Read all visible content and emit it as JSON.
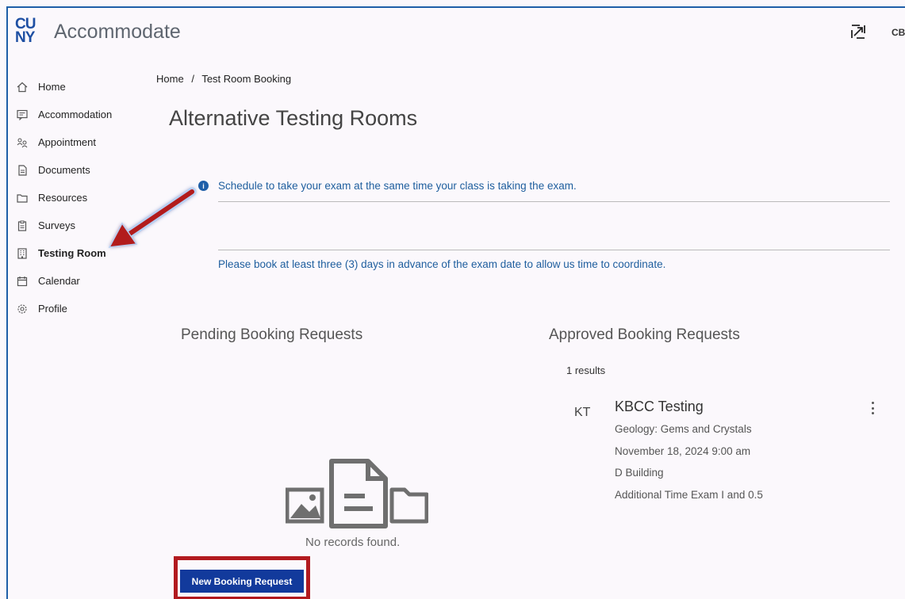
{
  "header": {
    "logo_line1": "CU",
    "logo_line2": "NY",
    "app_title": "Accommodate",
    "user_initials": "CB"
  },
  "sidebar": {
    "items": [
      {
        "label": "Home",
        "icon": "home-icon"
      },
      {
        "label": "Accommodation",
        "icon": "chat-icon"
      },
      {
        "label": "Appointment",
        "icon": "people-icon"
      },
      {
        "label": "Documents",
        "icon": "document-icon"
      },
      {
        "label": "Resources",
        "icon": "folder-icon"
      },
      {
        "label": "Surveys",
        "icon": "clipboard-icon"
      },
      {
        "label": "Testing Room",
        "icon": "building-icon",
        "active": true
      },
      {
        "label": "Calendar",
        "icon": "calendar-icon"
      },
      {
        "label": "Profile",
        "icon": "gear-icon"
      }
    ]
  },
  "breadcrumb": {
    "home": "Home",
    "separator": "/",
    "current": "Test Room Booking"
  },
  "page": {
    "title": "Alternative Testing Rooms",
    "info_text": "Schedule to take your exam at the same time your class is taking the exam.",
    "note_text": "Please book at least three (3) days in advance of the exam date to allow us time to coordinate."
  },
  "pending": {
    "title": "Pending Booking Requests",
    "empty_text": "No records found.",
    "new_button": "New Booking Request"
  },
  "approved": {
    "title": "Approved Booking Requests",
    "results": "1 results",
    "card": {
      "avatar": "KT",
      "title": "KBCC Testing",
      "course": "Geology: Gems and Crystals",
      "datetime": "November 18, 2024 9:00 am",
      "location": "D Building",
      "accommodation": "Additional Time Exam I and 0.5"
    }
  },
  "colors": {
    "brand_blue": "#1e4fa3",
    "link_blue": "#1e5e9e",
    "button_blue": "#123a9c",
    "highlight_red": "#b21a1f"
  }
}
